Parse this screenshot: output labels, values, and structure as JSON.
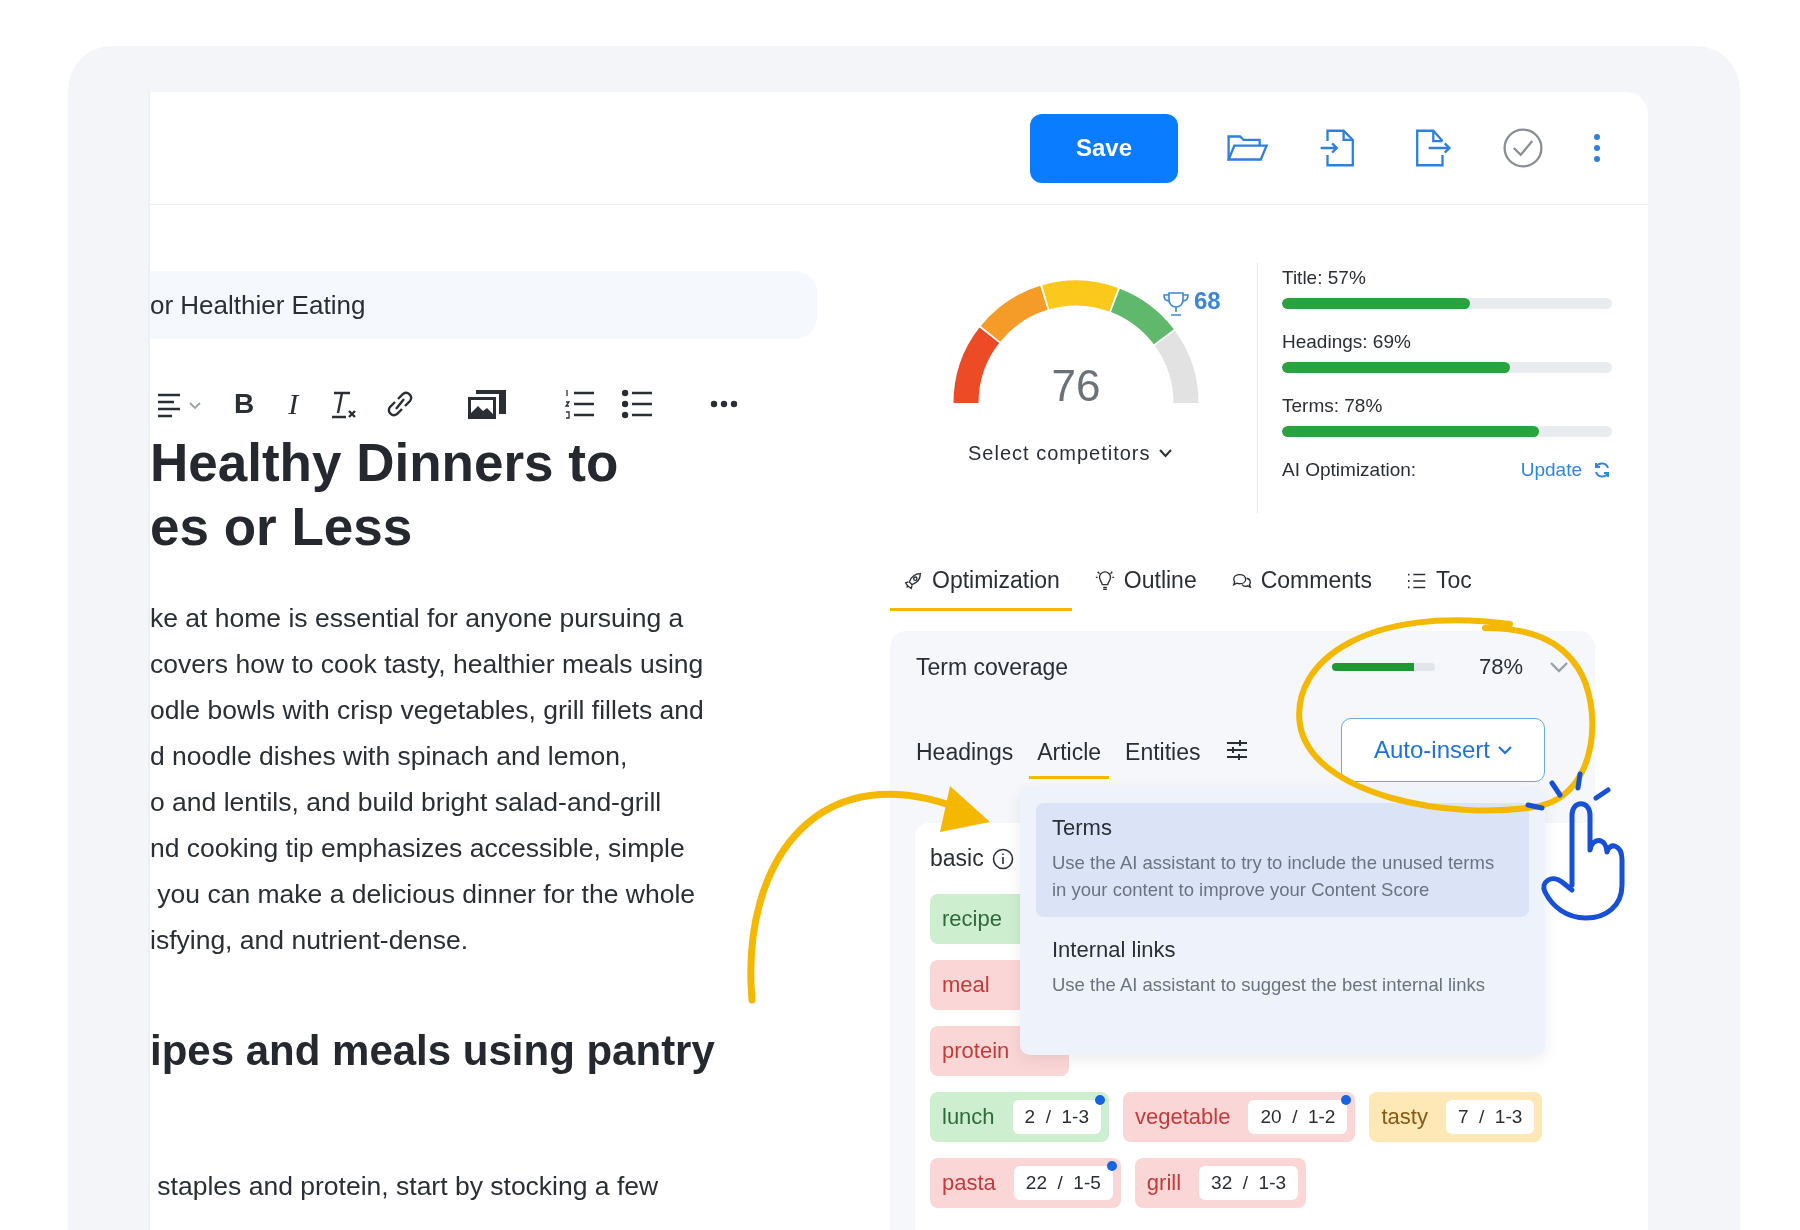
{
  "toolbar": {
    "save": "Save"
  },
  "editor": {
    "title_value": "or Healthier Eating",
    "format_buttons": [
      {
        "kind": "bold",
        "label": "B"
      },
      {
        "kind": "italic",
        "label": "I"
      }
    ],
    "heading_lines": [
      "Healthy Dinners to",
      "es or Less"
    ],
    "paragraph_lines": [
      "ke at home is essential for anyone pursuing a",
      "covers how to cook tasty, healthier meals using",
      "odle bowls with crisp vegetables, grill fillets and",
      "d noodle dishes with spinach and lemon,",
      "o and lentils, and build bright salad-and-grill",
      "nd cooking tip emphasizes accessible, simple",
      " you can make a delicious dinner for the whole",
      "isfying, and nutrient-dense."
    ],
    "subheading": "ipes and meals using pantry",
    "last_line": " staples and protein, start by stocking a few"
  },
  "score": {
    "value": "76",
    "competitor_score": "68",
    "competitors": "Select competitors"
  },
  "metrics": [
    {
      "label": "Title: 57%",
      "level": 0.57
    },
    {
      "label": "Headings: 69%",
      "level": 0.69
    },
    {
      "label": "Terms: 78%",
      "level": 0.78
    }
  ],
  "ai_optimization": {
    "label": "AI Optimization:",
    "action": "Update"
  },
  "tabs": [
    {
      "label": "Optimization",
      "kind": "rocket",
      "selected": true
    },
    {
      "label": "Outline",
      "kind": "bulb",
      "selected": false
    },
    {
      "label": "Comments",
      "kind": "comments",
      "selected": false
    },
    {
      "label": "Toc",
      "kind": "list",
      "selected": false
    }
  ],
  "term_coverage": {
    "title": "Term coverage",
    "level": 0.8,
    "reading": "78%",
    "subtabs": [
      {
        "label": "Headings",
        "selected": false
      },
      {
        "label": "Article",
        "selected": true
      },
      {
        "label": "Entities",
        "selected": false
      }
    ],
    "auto_insert": "Auto-insert",
    "group": "basic",
    "chip_rows": [
      [
        {
          "label": "recipe",
          "color": "#cdeecf"
        }
      ],
      [
        {
          "label": "meal",
          "color": "#fbd6d6"
        }
      ],
      [
        {
          "label": "protein",
          "color": "#fbd6d6"
        }
      ],
      [
        {
          "label": "lunch",
          "count": "2  /  1-3",
          "color": "#cdeecf",
          "marked": true
        },
        {
          "label": "vegetable",
          "count": "20  /  1-2",
          "color": "#fbd6d6",
          "marked": true
        },
        {
          "label": "tasty",
          "count": "7  /  1-3",
          "color": "#fde8b6",
          "marked": false
        }
      ],
      [
        {
          "label": "pasta",
          "count": "22  /  1-5",
          "color": "#fbd6d6",
          "marked": true
        },
        {
          "label": "grill",
          "count": "32  /  1-3",
          "color": "#fbd6d6",
          "marked": false
        }
      ]
    ],
    "menu": [
      {
        "title": "Terms",
        "description": "Use the AI assistant to try to include the unused terms in your content to improve your Content Score",
        "selected": true
      },
      {
        "title": "Internal links",
        "description": "Use the AI assistant to suggest the best internal links",
        "selected": false
      }
    ]
  }
}
